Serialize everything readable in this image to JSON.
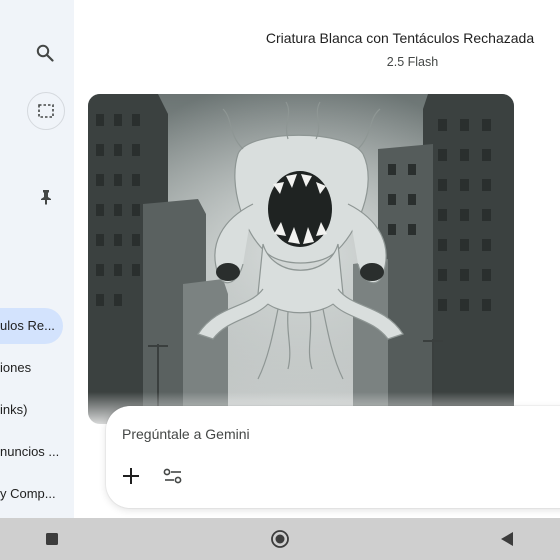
{
  "header": {
    "title": "Criatura Blanca con Tentáculos Rechazada",
    "model": "2.5 Flash"
  },
  "sidebar": {
    "icons": [
      "search-icon",
      "select-icon",
      "pin-icon"
    ],
    "items": [
      {
        "label": "ulos Re...",
        "active": true
      },
      {
        "label": "iones",
        "active": false
      },
      {
        "label": "inks)",
        "active": false
      },
      {
        "label": "nuncios ...",
        "active": false
      },
      {
        "label": "y Comp...",
        "active": false
      }
    ]
  },
  "image": {
    "description_icon": "generated-image"
  },
  "input": {
    "placeholder": "Pregúntale a Gemini",
    "icons": [
      "add-icon",
      "tools-icon"
    ]
  },
  "navbar": {
    "icons": [
      "recents-icon",
      "home-icon",
      "back-icon"
    ]
  },
  "colors": {
    "sidebar_bg": "#f0f4f9",
    "active_item": "#d3e3fd",
    "navbar_bg": "#cfcfcf"
  }
}
